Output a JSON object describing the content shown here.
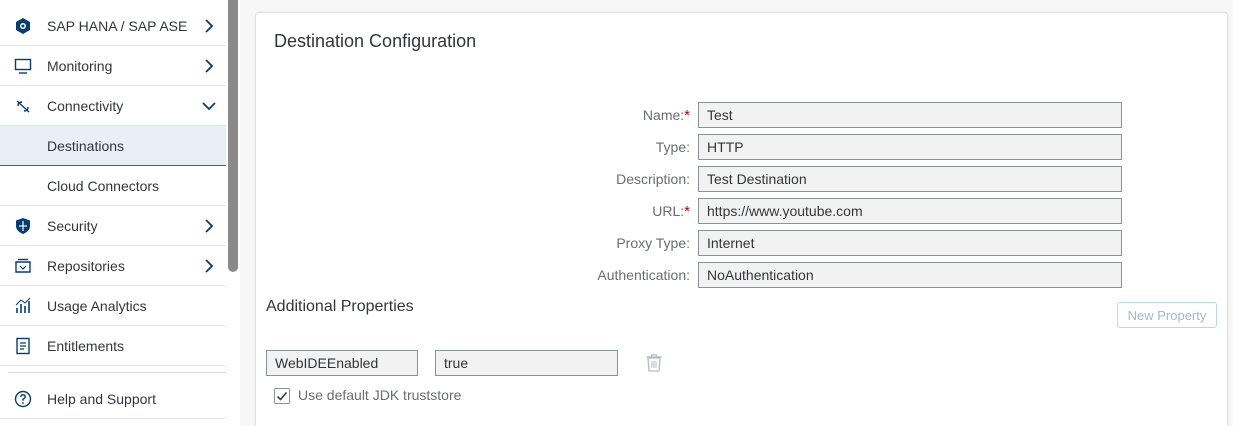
{
  "sidebar": {
    "items": [
      {
        "label": "SAP HANA / SAP ASE",
        "icon": "database-icon",
        "chevron": "right"
      },
      {
        "label": "Monitoring",
        "icon": "monitor-icon",
        "chevron": "right"
      },
      {
        "label": "Connectivity",
        "icon": "connectivity-icon",
        "chevron": "down"
      },
      {
        "label": "Destinations",
        "icon": "",
        "chevron": "",
        "selected": true
      },
      {
        "label": "Cloud Connectors",
        "icon": "",
        "chevron": ""
      },
      {
        "label": "Security",
        "icon": "shield-icon",
        "chevron": "right"
      },
      {
        "label": "Repositories",
        "icon": "repository-icon",
        "chevron": "right"
      },
      {
        "label": "Usage Analytics",
        "icon": "analytics-icon",
        "chevron": ""
      },
      {
        "label": "Entitlements",
        "icon": "entitlements-icon",
        "chevron": ""
      }
    ],
    "help": {
      "label": "Help and Support",
      "icon": "help-icon"
    }
  },
  "main": {
    "title": "Destination Configuration",
    "form": {
      "name_label": "Name:",
      "name_value": "Test",
      "type_label": "Type:",
      "type_value": "HTTP",
      "description_label": "Description:",
      "description_value": "Test Destination",
      "url_label": "URL:",
      "url_value": "https://www.youtube.com",
      "proxy_label": "Proxy Type:",
      "proxy_value": "Internet",
      "auth_label": "Authentication:",
      "auth_value": "NoAuthentication",
      "required_marker": "*"
    },
    "additional": {
      "title": "Additional Properties",
      "new_property_label": "New Property",
      "property_key": "WebIDEEnabled",
      "property_value": "true"
    },
    "truststore": {
      "label": "Use default JDK truststore",
      "checked": true
    }
  },
  "colors": {
    "accent": "#0a6ed1",
    "selected_bg": "#e8eff6",
    "required": "#bb0000"
  }
}
